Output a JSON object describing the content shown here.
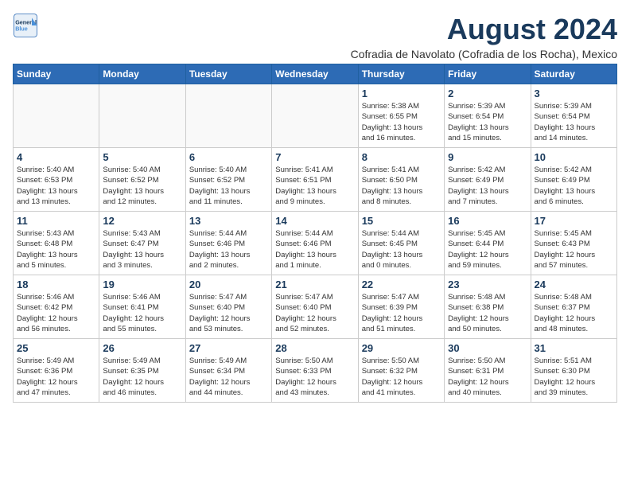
{
  "logo": {
    "line1": "General",
    "line2": "Blue"
  },
  "title": "August 2024",
  "subtitle": "Cofradia de Navolato (Cofradia de los Rocha), Mexico",
  "days_of_week": [
    "Sunday",
    "Monday",
    "Tuesday",
    "Wednesday",
    "Thursday",
    "Friday",
    "Saturday"
  ],
  "weeks": [
    [
      {
        "day": "",
        "info": ""
      },
      {
        "day": "",
        "info": ""
      },
      {
        "day": "",
        "info": ""
      },
      {
        "day": "",
        "info": ""
      },
      {
        "day": "1",
        "info": "Sunrise: 5:38 AM\nSunset: 6:55 PM\nDaylight: 13 hours\nand 16 minutes."
      },
      {
        "day": "2",
        "info": "Sunrise: 5:39 AM\nSunset: 6:54 PM\nDaylight: 13 hours\nand 15 minutes."
      },
      {
        "day": "3",
        "info": "Sunrise: 5:39 AM\nSunset: 6:54 PM\nDaylight: 13 hours\nand 14 minutes."
      }
    ],
    [
      {
        "day": "4",
        "info": "Sunrise: 5:40 AM\nSunset: 6:53 PM\nDaylight: 13 hours\nand 13 minutes."
      },
      {
        "day": "5",
        "info": "Sunrise: 5:40 AM\nSunset: 6:52 PM\nDaylight: 13 hours\nand 12 minutes."
      },
      {
        "day": "6",
        "info": "Sunrise: 5:40 AM\nSunset: 6:52 PM\nDaylight: 13 hours\nand 11 minutes."
      },
      {
        "day": "7",
        "info": "Sunrise: 5:41 AM\nSunset: 6:51 PM\nDaylight: 13 hours\nand 9 minutes."
      },
      {
        "day": "8",
        "info": "Sunrise: 5:41 AM\nSunset: 6:50 PM\nDaylight: 13 hours\nand 8 minutes."
      },
      {
        "day": "9",
        "info": "Sunrise: 5:42 AM\nSunset: 6:49 PM\nDaylight: 13 hours\nand 7 minutes."
      },
      {
        "day": "10",
        "info": "Sunrise: 5:42 AM\nSunset: 6:49 PM\nDaylight: 13 hours\nand 6 minutes."
      }
    ],
    [
      {
        "day": "11",
        "info": "Sunrise: 5:43 AM\nSunset: 6:48 PM\nDaylight: 13 hours\nand 5 minutes."
      },
      {
        "day": "12",
        "info": "Sunrise: 5:43 AM\nSunset: 6:47 PM\nDaylight: 13 hours\nand 3 minutes."
      },
      {
        "day": "13",
        "info": "Sunrise: 5:44 AM\nSunset: 6:46 PM\nDaylight: 13 hours\nand 2 minutes."
      },
      {
        "day": "14",
        "info": "Sunrise: 5:44 AM\nSunset: 6:46 PM\nDaylight: 13 hours\nand 1 minute."
      },
      {
        "day": "15",
        "info": "Sunrise: 5:44 AM\nSunset: 6:45 PM\nDaylight: 13 hours\nand 0 minutes."
      },
      {
        "day": "16",
        "info": "Sunrise: 5:45 AM\nSunset: 6:44 PM\nDaylight: 12 hours\nand 59 minutes."
      },
      {
        "day": "17",
        "info": "Sunrise: 5:45 AM\nSunset: 6:43 PM\nDaylight: 12 hours\nand 57 minutes."
      }
    ],
    [
      {
        "day": "18",
        "info": "Sunrise: 5:46 AM\nSunset: 6:42 PM\nDaylight: 12 hours\nand 56 minutes."
      },
      {
        "day": "19",
        "info": "Sunrise: 5:46 AM\nSunset: 6:41 PM\nDaylight: 12 hours\nand 55 minutes."
      },
      {
        "day": "20",
        "info": "Sunrise: 5:47 AM\nSunset: 6:40 PM\nDaylight: 12 hours\nand 53 minutes."
      },
      {
        "day": "21",
        "info": "Sunrise: 5:47 AM\nSunset: 6:40 PM\nDaylight: 12 hours\nand 52 minutes."
      },
      {
        "day": "22",
        "info": "Sunrise: 5:47 AM\nSunset: 6:39 PM\nDaylight: 12 hours\nand 51 minutes."
      },
      {
        "day": "23",
        "info": "Sunrise: 5:48 AM\nSunset: 6:38 PM\nDaylight: 12 hours\nand 50 minutes."
      },
      {
        "day": "24",
        "info": "Sunrise: 5:48 AM\nSunset: 6:37 PM\nDaylight: 12 hours\nand 48 minutes."
      }
    ],
    [
      {
        "day": "25",
        "info": "Sunrise: 5:49 AM\nSunset: 6:36 PM\nDaylight: 12 hours\nand 47 minutes."
      },
      {
        "day": "26",
        "info": "Sunrise: 5:49 AM\nSunset: 6:35 PM\nDaylight: 12 hours\nand 46 minutes."
      },
      {
        "day": "27",
        "info": "Sunrise: 5:49 AM\nSunset: 6:34 PM\nDaylight: 12 hours\nand 44 minutes."
      },
      {
        "day": "28",
        "info": "Sunrise: 5:50 AM\nSunset: 6:33 PM\nDaylight: 12 hours\nand 43 minutes."
      },
      {
        "day": "29",
        "info": "Sunrise: 5:50 AM\nSunset: 6:32 PM\nDaylight: 12 hours\nand 41 minutes."
      },
      {
        "day": "30",
        "info": "Sunrise: 5:50 AM\nSunset: 6:31 PM\nDaylight: 12 hours\nand 40 minutes."
      },
      {
        "day": "31",
        "info": "Sunrise: 5:51 AM\nSunset: 6:30 PM\nDaylight: 12 hours\nand 39 minutes."
      }
    ]
  ]
}
